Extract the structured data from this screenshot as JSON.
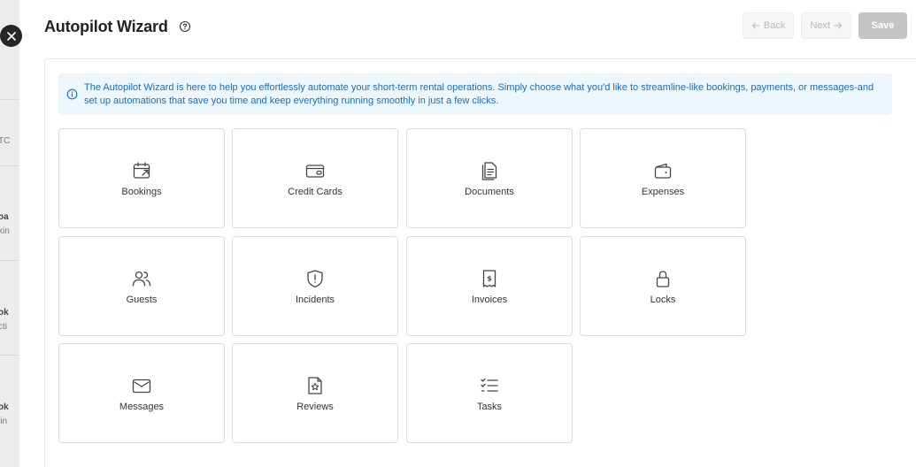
{
  "background_fragments": [
    "TC",
    "oa",
    "kin",
    "ok",
    "cti",
    "ok",
    "lin"
  ],
  "header": {
    "title": "Autopilot Wizard",
    "back_label": "Back",
    "next_label": "Next",
    "save_label": "Save"
  },
  "info": {
    "text": "The Autopilot Wizard is here to help you effortlessly automate your short-term rental operations. Simply choose what you'd like to streamline-like bookings, payments, or messages-and set up automations that save you time and keep everything running smoothly in just a few clicks."
  },
  "tiles": [
    {
      "label": "Bookings",
      "icon": "calendar-arrow-icon"
    },
    {
      "label": "Credit Cards",
      "icon": "credit-card-icon"
    },
    {
      "label": "Documents",
      "icon": "documents-icon"
    },
    {
      "label": "Expenses",
      "icon": "wallet-icon"
    },
    {
      "label": "Guests",
      "icon": "users-icon"
    },
    {
      "label": "Incidents",
      "icon": "shield-alert-icon"
    },
    {
      "label": "Invoices",
      "icon": "receipt-icon"
    },
    {
      "label": "Locks",
      "icon": "lock-icon"
    },
    {
      "label": "Messages",
      "icon": "mail-icon"
    },
    {
      "label": "Reviews",
      "icon": "file-star-icon"
    },
    {
      "label": "Tasks",
      "icon": "list-checks-icon"
    }
  ],
  "colors": {
    "accent_info": "#1a6fb0",
    "info_bg": "#eef6fd",
    "save_disabled": "#c4c4c4",
    "close_bg": "#262626"
  }
}
